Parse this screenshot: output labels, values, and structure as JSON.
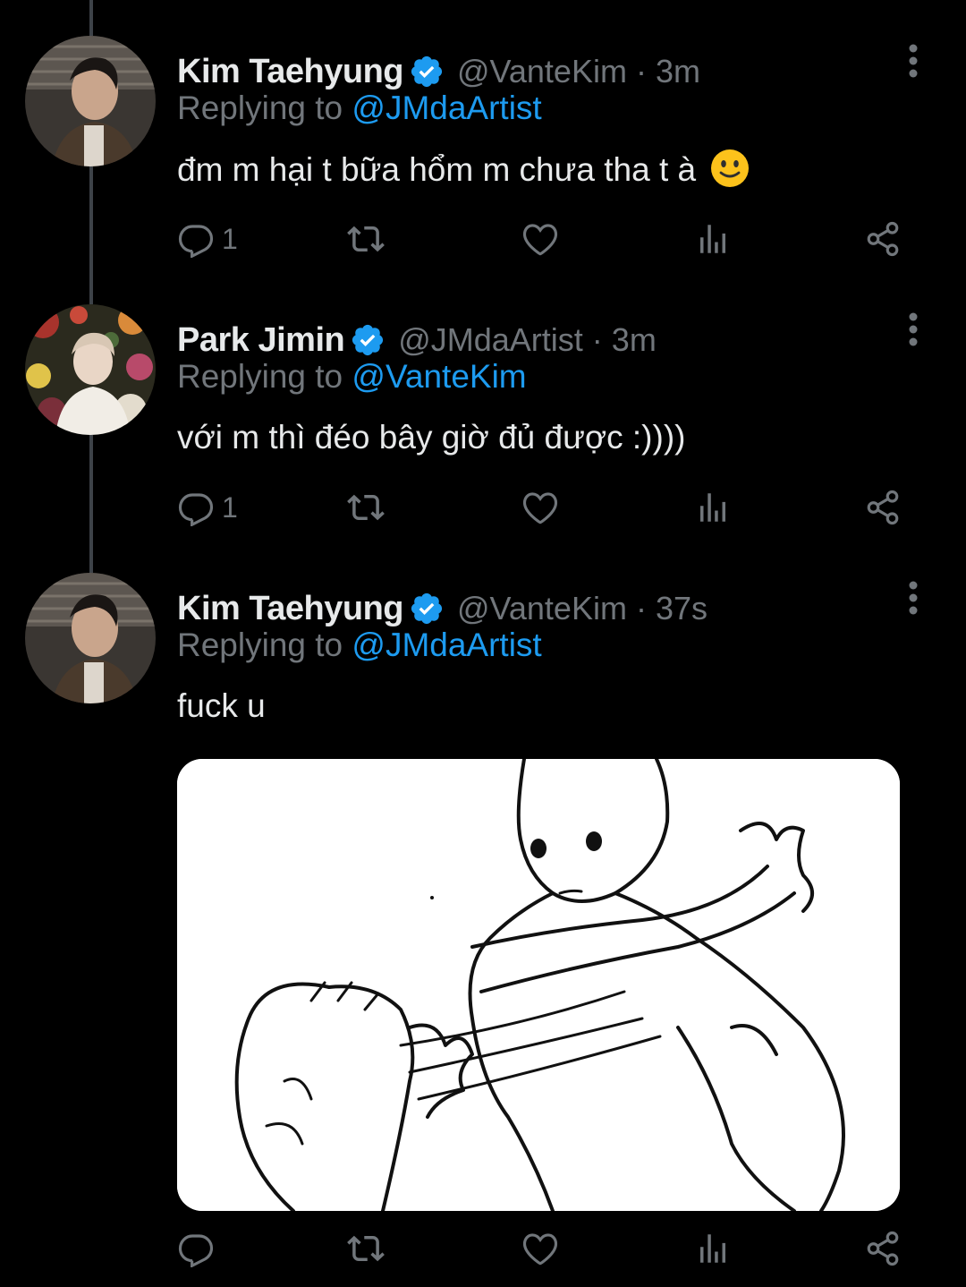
{
  "tweets": [
    {
      "name": "Kim Taehyung",
      "handle": "@VanteKim",
      "separator": "·",
      "time": "3m",
      "replying_prefix": "Replying to",
      "replying_to": "@JMdaArtist",
      "text": "đm m hại t bữa hổm m chưa tha t à",
      "emoji": "slightly-smiling-face",
      "reply_count": "1"
    },
    {
      "name": "Park Jimin",
      "handle": "@JMdaArtist",
      "separator": "·",
      "time": "3m",
      "replying_prefix": "Replying to",
      "replying_to": "@VanteKim",
      "text": "với m thì đéo bây giờ đủ được :))))",
      "reply_count": "1"
    },
    {
      "name": "Kim Taehyung",
      "handle": "@VanteKim",
      "separator": "·",
      "time": "37s",
      "replying_prefix": "Replying to",
      "replying_to": "@JMdaArtist",
      "text": "fuck u",
      "reply_count": "",
      "media": "cartoon-slap-image"
    }
  ],
  "colors": {
    "background": "#000000",
    "text": "#e7e9ea",
    "muted": "#71767b",
    "accent": "#1d9bf0",
    "thread_line": "#3d4248"
  },
  "icons": [
    "reply-icon",
    "retweet-icon",
    "like-icon",
    "views-icon",
    "share-icon",
    "more-icon",
    "verified-badge-icon"
  ]
}
